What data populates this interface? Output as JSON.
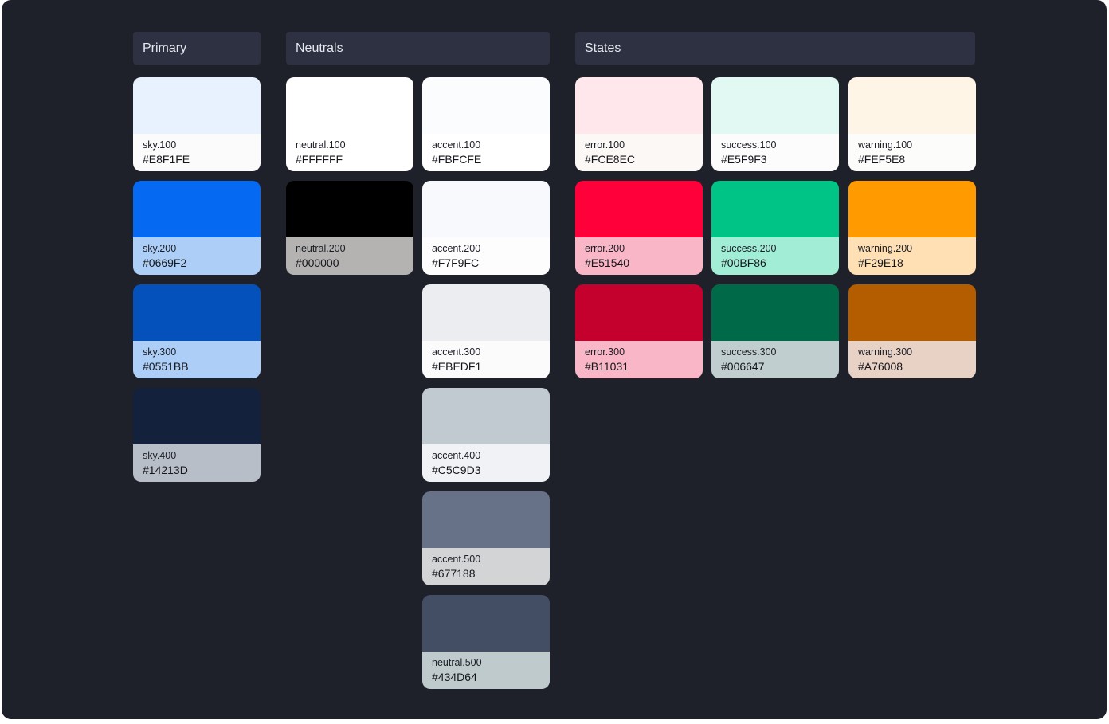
{
  "sections": [
    {
      "title": "Primary",
      "columns": [
        [
          {
            "token": "sky.100",
            "hex": "#E8F1FE",
            "color": "#E8F1FE",
            "info_bg": "#FBFBFB"
          },
          {
            "token": "sky.200",
            "hex": "#0669F2",
            "color": "#0669F2",
            "info_bg": "#ADCFF7"
          },
          {
            "token": "sky.300",
            "hex": "#0551BB",
            "color": "#0551BB",
            "info_bg": "#ADCFF7"
          },
          {
            "token": "sky.400",
            "hex": "#14213D",
            "color": "#14213D",
            "info_bg": "#B8BEC7"
          }
        ]
      ]
    },
    {
      "title": "Neutrals",
      "columns": [
        [
          {
            "token": "neutral.100",
            "hex": "#FFFFFF",
            "color": "#FFFFFF",
            "info_bg": "#FFFFFF"
          },
          {
            "token": "neutral.200",
            "hex": "#000000",
            "color": "#000000",
            "info_bg": "#B4B3B1"
          }
        ],
        [
          {
            "token": "accent.100",
            "hex": "#FBFCFE",
            "color": "#FBFCFE",
            "info_bg": "#FFFFFF"
          },
          {
            "token": "accent.200",
            "hex": "#F7F9FC",
            "color": "#F7F9FC",
            "info_bg": "#FDFDFD"
          },
          {
            "token": "accent.300",
            "hex": "#EBEDF1",
            "color": "#EBEDF1",
            "info_bg": "#FBFBFB"
          },
          {
            "token": "accent.400",
            "hex": "#C5C9D3",
            "color": "#C0CAD0",
            "info_bg": "#F0F2F6"
          },
          {
            "token": "accent.500",
            "hex": "#677188",
            "color": "#677188",
            "info_bg": "#D3D4D6"
          },
          {
            "token": "neutral.500",
            "hex": "#434D64",
            "color": "#434D64",
            "info_bg": "#BFCACD"
          }
        ]
      ]
    },
    {
      "title": "States",
      "columns": [
        [
          {
            "token": "error.100",
            "hex": "#FCE8EC",
            "color": "#FFE7EB",
            "info_bg": "#FCF8F5"
          },
          {
            "token": "error.200",
            "hex": "#E51540",
            "color": "#FF003A",
            "info_bg": "#F8B6C6"
          },
          {
            "token": "error.300",
            "hex": "#B11031",
            "color": "#C4002C",
            "info_bg": "#F8B6C6"
          }
        ],
        [
          {
            "token": "success.100",
            "hex": "#E5F9F3",
            "color": "#E1F9F2",
            "info_bg": "#FBFCFB"
          },
          {
            "token": "success.200",
            "hex": "#00BF86",
            "color": "#00C486",
            "info_bg": "#A2EDD6"
          },
          {
            "token": "success.300",
            "hex": "#006647",
            "color": "#006A48",
            "info_bg": "#C0CECF"
          }
        ],
        [
          {
            "token": "warning.100",
            "hex": "#FEF5E8",
            "color": "#FEF5E7",
            "info_bg": "#FCFCFB"
          },
          {
            "token": "warning.200",
            "hex": "#F29E18",
            "color": "#FF9A00",
            "info_bg": "#FFE0B4"
          },
          {
            "token": "warning.300",
            "hex": "#A76008",
            "color": "#B35C00",
            "info_bg": "#E8D2C5"
          }
        ]
      ]
    }
  ]
}
